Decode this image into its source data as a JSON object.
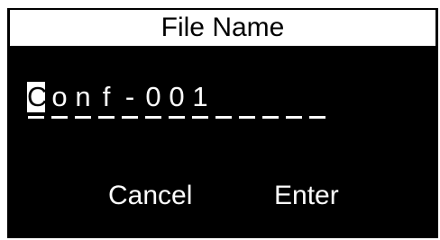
{
  "dialog": {
    "title": "File Name",
    "characters": [
      "C",
      "o",
      "n",
      "f",
      "-",
      "0",
      "0",
      "1",
      "",
      "",
      "",
      "",
      ""
    ],
    "selected_index": 0,
    "cancel_label": "Cancel",
    "enter_label": "Enter"
  },
  "colors": {
    "background": "#000000",
    "foreground": "#ffffff"
  }
}
